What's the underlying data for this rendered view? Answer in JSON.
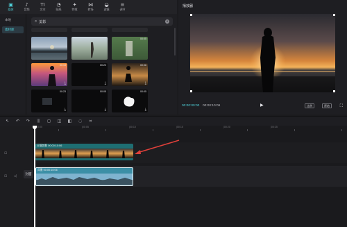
{
  "toolbar": {
    "tools": [
      {
        "label": "媒体",
        "icon": "media-icon",
        "glyph": "▣",
        "active": true
      },
      {
        "label": "音频",
        "icon": "audio-icon",
        "glyph": "♪",
        "active": false
      },
      {
        "label": "文本",
        "icon": "text-icon",
        "glyph": "TI",
        "active": false
      },
      {
        "label": "贴纸",
        "icon": "sticker-icon",
        "glyph": "◔",
        "active": false
      },
      {
        "label": "特效",
        "icon": "effects-icon",
        "glyph": "✦",
        "active": false
      },
      {
        "label": "转场",
        "icon": "transition-icon",
        "glyph": "⋈",
        "active": false
      },
      {
        "label": "滤镜",
        "icon": "filter-icon",
        "glyph": "◒",
        "active": false
      },
      {
        "label": "调节",
        "icon": "adjust-icon",
        "glyph": "≡",
        "active": false
      }
    ]
  },
  "sidebar": {
    "items": [
      {
        "label": "本地",
        "active": false
      },
      {
        "label": "素材库",
        "active": true
      }
    ]
  },
  "search": {
    "value": "剪影",
    "clear_icon": "✕",
    "search_glyph": "⌕"
  },
  "media": {
    "thumbs": [
      {
        "duration": "",
        "downloaded": false
      },
      {
        "duration": "",
        "downloaded": false
      },
      {
        "duration": "",
        "downloaded": false
      },
      {
        "duration": "",
        "downloaded": false
      },
      {
        "duration": "",
        "downloaded": false
      },
      {
        "duration": "00:05",
        "downloaded": false
      },
      {
        "duration": "00:13",
        "downloaded": true
      },
      {
        "duration": "00:22",
        "downloaded": true
      },
      {
        "duration": "00:08",
        "downloaded": true
      },
      {
        "duration": "00:23",
        "downloaded": true
      },
      {
        "duration": "00:05",
        "downloaded": true
      },
      {
        "duration": "00:05",
        "downloaded": true
      }
    ]
  },
  "player": {
    "title": "播放器",
    "current_time": "00:00:00:00",
    "total_time": "00:00:10:06",
    "play_glyph": "▶",
    "ratio_label": "比例",
    "original_label": "原始",
    "fullscreen_glyph": "⛶"
  },
  "timeline_tools": [
    {
      "name": "select-tool-icon",
      "glyph": "↖"
    },
    {
      "name": "undo-icon",
      "glyph": "↶"
    },
    {
      "name": "redo-icon",
      "glyph": "↷"
    },
    {
      "name": "split-icon",
      "glyph": "⫼"
    },
    {
      "name": "delete-icon",
      "glyph": "◻"
    },
    {
      "name": "freeze-icon",
      "glyph": "◫"
    },
    {
      "name": "mirror-icon",
      "glyph": "◧"
    },
    {
      "name": "rotate-icon",
      "glyph": "◌"
    },
    {
      "name": "crop-icon",
      "glyph": "⌗"
    }
  ],
  "ruler": {
    "labels": [
      "00:00",
      "|00:05",
      "|00:10",
      "|00:15",
      "|00:20",
      "|00:25"
    ]
  },
  "clips": {
    "overlay_label": "日落剪影 00:00:10:06",
    "main_label": "风景 00:00:10:06"
  },
  "track": {
    "cover_label": "封面",
    "audio_icon": "◂)",
    "lock_icon": "⊟"
  },
  "colors": {
    "accent": "#4fd0d8",
    "overlay_clip": "#1e6e72",
    "main_clip": "#3c8fa6",
    "arrow": "#e0403a"
  }
}
